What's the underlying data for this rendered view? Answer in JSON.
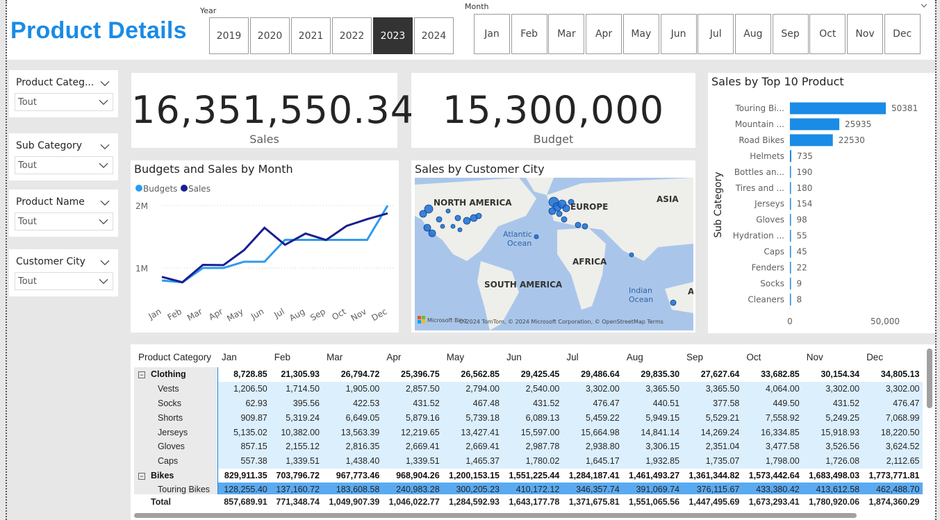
{
  "page": {
    "title": "Product Details"
  },
  "year_slicer": {
    "caption": "Year",
    "options": [
      "2019",
      "2020",
      "2021",
      "2022",
      "2023",
      "2024"
    ],
    "selected": "2023"
  },
  "month_slicer": {
    "caption": "Month",
    "options": [
      "Jan",
      "Feb",
      "Mar",
      "Apr",
      "May",
      "Jun",
      "Jul",
      "Aug",
      "Sep",
      "Oct",
      "Nov",
      "Dec"
    ]
  },
  "filters": [
    {
      "label": "Product Categ...",
      "value": "Tout"
    },
    {
      "label": "Sub Category",
      "value": "Tout"
    },
    {
      "label": "Product Name",
      "value": "Tout"
    },
    {
      "label": "Customer City",
      "value": "Tout"
    }
  ],
  "kpis": {
    "sales_value": "16,351,550.34",
    "sales_label": "Sales",
    "budget_value": "15,300,000",
    "budget_label": "Budget"
  },
  "line_chart": {
    "title": "Budgets and Sales by Month",
    "legend": [
      "Budgets",
      "Sales"
    ],
    "colors": {
      "budgets": "#2d9bf0",
      "sales": "#1b1f8f"
    }
  },
  "map": {
    "title": "Sales by Customer City",
    "labels": {
      "na": "NORTH AMERICA",
      "eu": "EUROPE",
      "asia": "ASIA",
      "atl": "Atlantic",
      "atl2": "Ocean",
      "africa": "AFRICA",
      "sa": "SOUTH AMERICA",
      "ind": "Indian",
      "ind2": "Ocean",
      "a": "A"
    },
    "attribution": "© 2024 TomTom, © 2024 Microsoft Corporation, © OpenStreetMap  Terms",
    "brand": "Microsoft Bing"
  },
  "bar_chart": {
    "title": "Sales by Top 10 Product",
    "ylabel": "Sub Category",
    "tick0": "0",
    "tick1": "50,000"
  },
  "chart_data": [
    {
      "type": "line",
      "title": "Budgets and Sales by Month",
      "x": [
        "Jan",
        "Feb",
        "Mar",
        "Apr",
        "May",
        "Jun",
        "Jul",
        "Aug",
        "Sep",
        "Oct",
        "Nov",
        "Dec"
      ],
      "ylim": [
        0,
        2000000
      ],
      "yticks": [
        "1M",
        "2M"
      ],
      "series": [
        {
          "name": "Budgets",
          "values": [
            800000,
            770000,
            1000000,
            1000000,
            1100000,
            1100000,
            1450000,
            1450000,
            1450000,
            1450000,
            1450000,
            2000000
          ]
        },
        {
          "name": "Sales",
          "values": [
            857690,
            771349,
            1049907,
            1046023,
            1284593,
            1643178,
            1371676,
            1551066,
            1447496,
            1673293,
            1780920,
            1874360
          ]
        }
      ]
    },
    {
      "type": "bar",
      "title": "Sales by Top 10 Product",
      "ylabel": "Sub Category",
      "xlim": [
        0,
        50000
      ],
      "categories": [
        "Touring Bi...",
        "Mountain ...",
        "Road Bikes",
        "Helmets",
        "Bottles an...",
        "Tires and ...",
        "Jerseys",
        "Gloves",
        "Hydration ...",
        "Caps",
        "Fenders",
        "Socks",
        "Cleaners"
      ],
      "values": [
        50381,
        25935,
        22530,
        735,
        190,
        180,
        154,
        98,
        55,
        45,
        22,
        9,
        8
      ]
    }
  ],
  "matrix": {
    "corner": "Product Category",
    "months": [
      "Jan",
      "Feb",
      "Mar",
      "Apr",
      "May",
      "Jun",
      "Jul",
      "Aug",
      "Sep",
      "Oct",
      "Nov",
      "Dec"
    ],
    "rows": [
      {
        "kind": "grp",
        "label": "Clothing",
        "vals": [
          "8,728.85",
          "21,305.93",
          "26,794.72",
          "25,396.75",
          "26,562.85",
          "29,425.45",
          "29,486.64",
          "29,835.30",
          "27,627.64",
          "33,682.85",
          "30,154.34",
          "34,805.13"
        ]
      },
      {
        "kind": "sub",
        "label": "Vests",
        "vals": [
          "1,206.50",
          "1,714.50",
          "1,905.00",
          "2,857.50",
          "2,794.00",
          "2,540.00",
          "3,302.00",
          "3,365.50",
          "3,365.50",
          "4,064.00",
          "3,302.00",
          "3,302.00"
        ]
      },
      {
        "kind": "sub",
        "label": "Socks",
        "vals": [
          "62.93",
          "395.56",
          "422.53",
          "431.52",
          "467.48",
          "431.52",
          "476.47",
          "440.51",
          "377.58",
          "449.50",
          "431.52",
          "476.47"
        ]
      },
      {
        "kind": "sub",
        "label": "Shorts",
        "vals": [
          "909.87",
          "5,319.24",
          "6,649.05",
          "5,879.16",
          "5,739.18",
          "6,089.13",
          "5,459.22",
          "5,949.15",
          "5,529.21",
          "7,558.92",
          "5,249.25",
          "7,068.99"
        ]
      },
      {
        "kind": "sub",
        "label": "Jerseys",
        "vals": [
          "5,135.02",
          "10,382.00",
          "13,563.39",
          "12,219.65",
          "13,427.41",
          "15,597.00",
          "15,664.98",
          "14,841.14",
          "14,269.24",
          "16,334.85",
          "15,918.93",
          "18,220.50"
        ]
      },
      {
        "kind": "sub",
        "label": "Gloves",
        "vals": [
          "857.15",
          "2,155.12",
          "2,816.35",
          "2,669.41",
          "2,669.41",
          "2,987.78",
          "2,938.80",
          "3,306.15",
          "2,351.04",
          "3,477.58",
          "3,526.56",
          "3,624.52"
        ]
      },
      {
        "kind": "sub",
        "label": "Caps",
        "vals": [
          "557.38",
          "1,339.51",
          "1,438.40",
          "1,339.51",
          "1,465.37",
          "1,780.02",
          "1,645.17",
          "1,932.85",
          "1,735.07",
          "1,798.00",
          "1,726.08",
          "2,112.65"
        ]
      },
      {
        "kind": "grp",
        "label": "Bikes",
        "vals": [
          "829,911.35",
          "703,796.72",
          "967,773.46",
          "968,904.26",
          "1,200,153.15",
          "1,551,225.44",
          "1,284,187.41",
          "1,461,493.27",
          "1,361,344.82",
          "1,573,442.64",
          "1,683,498.03",
          "1,773,771.81"
        ]
      },
      {
        "kind": "sub2",
        "label": "Touring Bikes",
        "vals": [
          "128,255.40",
          "137,160.72",
          "183,608.58",
          "240,983.28",
          "300,205.23",
          "410,172.12",
          "346,357.74",
          "391,069.74",
          "376,115.67",
          "433,380.42",
          "413,612.58",
          "462,488.70"
        ]
      }
    ],
    "total": {
      "label": "Total",
      "vals": [
        "857,689.91",
        "771,348.74",
        "1,049,907.39",
        "1,046,022.77",
        "1,284,592.93",
        "1,643,177.78",
        "1,371,675.81",
        "1,551,065.56",
        "1,447,495.69",
        "1,673,293.41",
        "1,780,920.06",
        "1,874,360.29"
      ]
    }
  },
  "colors": {
    "accent": "#1a8be6",
    "bar": "#1a8be6",
    "selected_year": "#333333"
  }
}
